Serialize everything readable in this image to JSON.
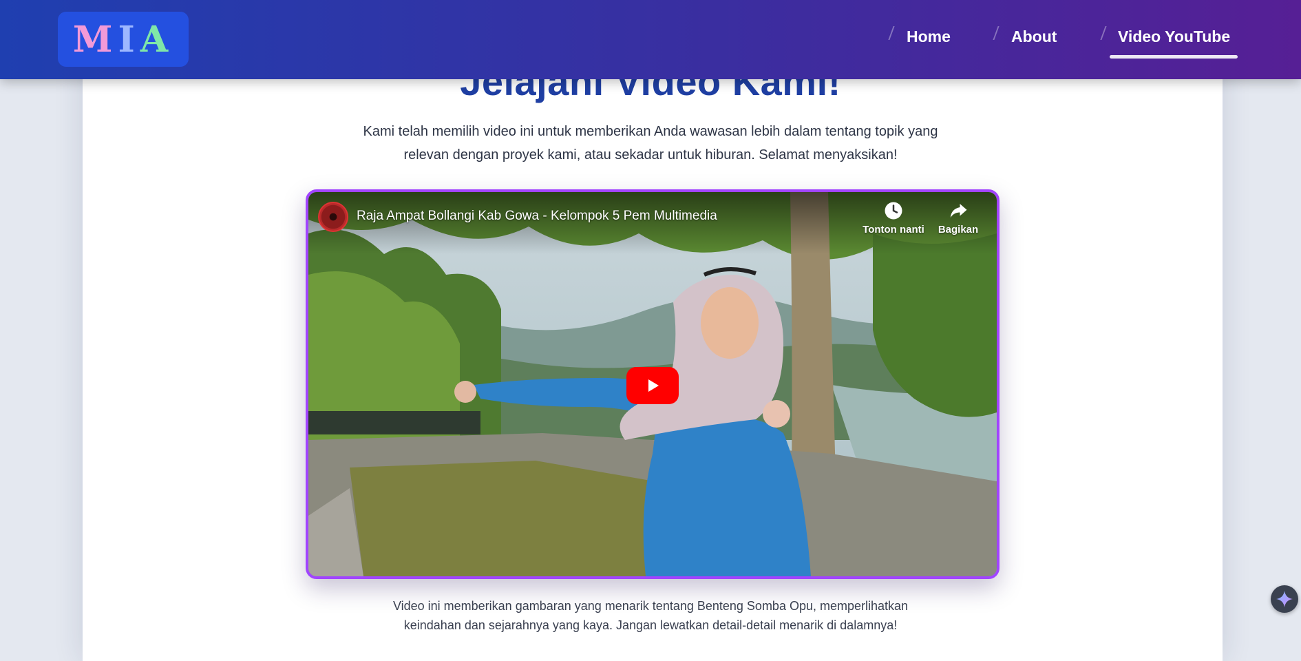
{
  "header": {
    "logo": {
      "letters": [
        "M",
        "I",
        "A"
      ],
      "colors": [
        "#f29ad8",
        "#9db7ff",
        "#7fe6a8"
      ]
    },
    "nav": [
      {
        "label": "Home",
        "active": false
      },
      {
        "label": "About",
        "active": false
      },
      {
        "label": "Video YouTube",
        "active": true
      }
    ]
  },
  "main": {
    "title": "Jelajahi Video Kami!",
    "intro": "Kami telah memilih video ini untuk memberikan Anda wawasan lebih dalam tentang topik yang relevan dengan proyek kami, atau sekadar untuk hiburan. Selamat menyaksikan!",
    "video": {
      "title": "Raja Ampat Bollangi Kab Gowa - Kelompok 5 Pem Multimedia",
      "watch_later_label": "Tonton nanti",
      "share_label": "Bagikan",
      "play_icon": "play-icon"
    },
    "caption": "Video ini memberikan gambaran yang menarik tentang Benteng Somba Opu, memperlihatkan keindahan dan sejarahnya yang kaya. Jangan lewatkan detail-detail menarik di dalamnya!"
  },
  "colors": {
    "header_start": "#1f3fb0",
    "header_end": "#561f95",
    "title": "#1f3fa3",
    "video_border": "#a144ff",
    "play": "#ff0000"
  },
  "floating_button": {
    "icon": "sparkle-icon"
  }
}
